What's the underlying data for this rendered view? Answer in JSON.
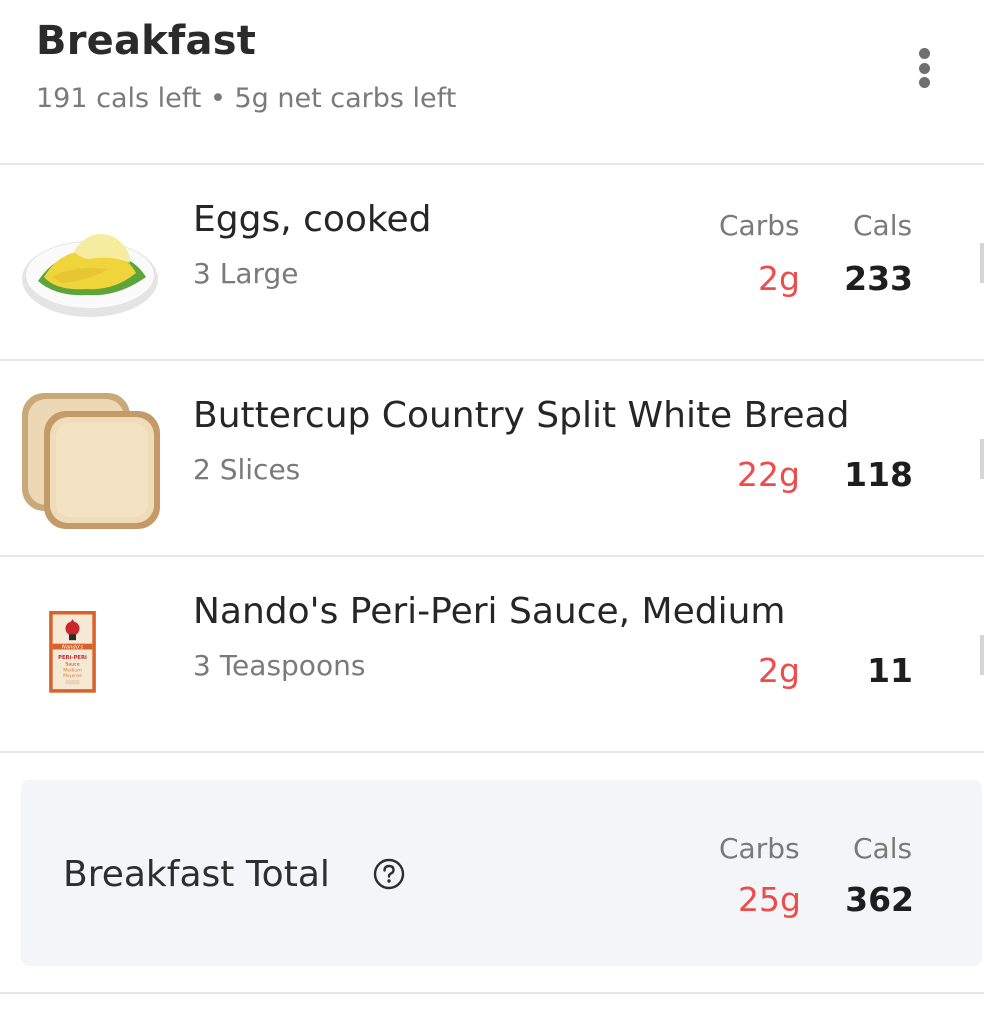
{
  "header": {
    "title": "Breakfast",
    "subtitle": "191 cals left • 5g net carbs left"
  },
  "columns": {
    "carbs": "Carbs",
    "cals": "Cals"
  },
  "foods": [
    {
      "name": "Eggs, cooked",
      "portion": "3 Large",
      "carbs": "2g",
      "cals": "233",
      "icon": "eggs-image"
    },
    {
      "name": "Buttercup Country Split White Bread",
      "portion": "2 Slices",
      "carbs": "22g",
      "cals": "118",
      "icon": "bread-image"
    },
    {
      "name": "Nando's Peri-Peri Sauce, Medium",
      "portion": "3 Teaspoons",
      "carbs": "2g",
      "cals": "11",
      "icon": "sauce-bottle-image"
    }
  ],
  "total": {
    "label": "Breakfast Total",
    "carbs": "25g",
    "cals": "362"
  },
  "colors": {
    "carbs": "#ef4b4b",
    "muted": "#7a7a7a",
    "card": "#f3f5f8"
  },
  "product_label": {
    "brand": "Nando's",
    "line1": "PERi-PERi",
    "line2": "Sauce",
    "line3": "Medium",
    "line4": "Moyenne"
  }
}
